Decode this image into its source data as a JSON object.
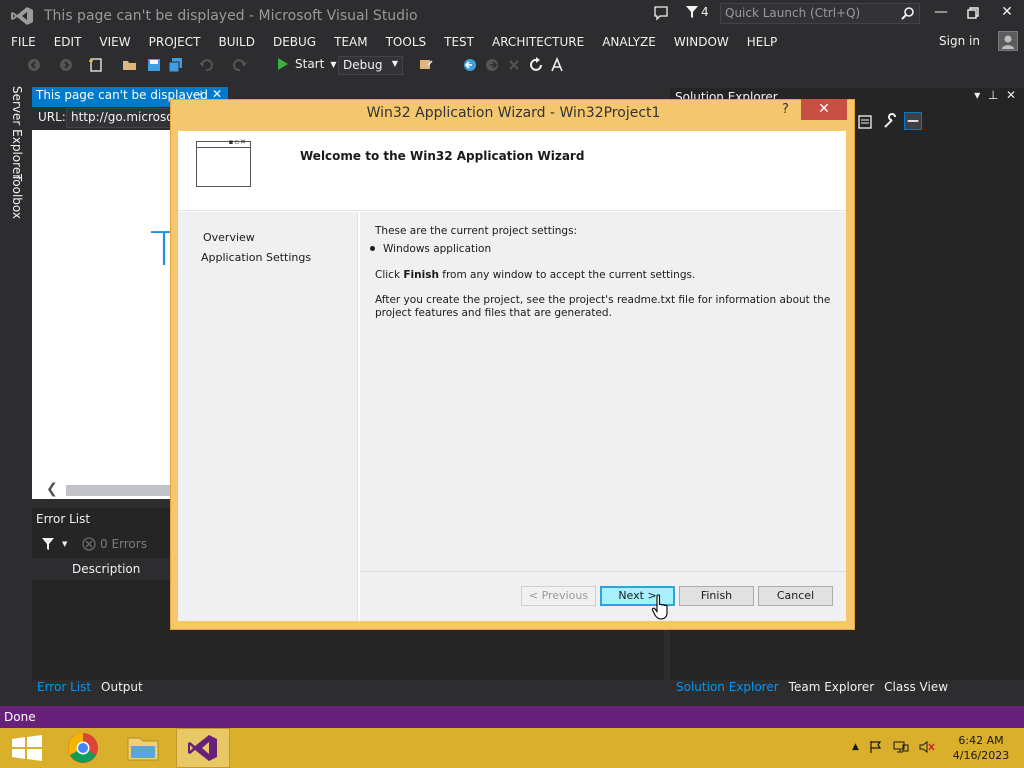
{
  "window": {
    "title": "This page can't be displayed - Microsoft Visual Studio",
    "notification_count": "4",
    "quick_launch_placeholder": "Quick Launch (Ctrl+Q)"
  },
  "menu": [
    "FILE",
    "EDIT",
    "VIEW",
    "PROJECT",
    "BUILD",
    "DEBUG",
    "TEAM",
    "TOOLS",
    "TEST",
    "ARCHITECTURE",
    "ANALYZE",
    "WINDOW",
    "HELP"
  ],
  "account": {
    "signin_label": "Sign in"
  },
  "toolbar": {
    "start_label": "Start",
    "config_value": "Debug"
  },
  "side_tabs": {
    "server_explorer": "Server Explorer",
    "toolbox": "Toolbox"
  },
  "document": {
    "tab_label": "This page can't be displayed",
    "url_label": "URL:",
    "url_value": "http://go.microsoft.com",
    "page_letter": "T"
  },
  "error_list": {
    "title": "Error List",
    "errors_label": "0 Errors",
    "column_description": "Description",
    "bottom_tabs": [
      "Error List",
      "Output"
    ]
  },
  "solution_explorer": {
    "title": "Solution Explorer",
    "bottom_tabs": [
      "Solution Explorer",
      "Team Explorer",
      "Class View"
    ]
  },
  "status": {
    "text": "Done"
  },
  "dialog": {
    "title": "Win32 Application Wizard - Win32Project1",
    "help_label": "?",
    "heading": "Welcome to the Win32 Application Wizard",
    "nav_items": [
      "Overview",
      "Application Settings"
    ],
    "settings_intro": "These are the current project settings:",
    "settings_bullet": "Windows application",
    "finish_pre": "Click ",
    "finish_bold": "Finish",
    "finish_post": " from any window to accept the current settings.",
    "readme_note": "After you create the project, see the project's readme.txt file for information about the project features and files that are generated.",
    "buttons": {
      "previous": "< Previous",
      "next": "Next >",
      "finish": "Finish",
      "cancel": "Cancel"
    }
  },
  "taskbar": {
    "time": "6:42 AM",
    "date": "4/16/2023"
  },
  "colors": {
    "vs_accent": "#007acc",
    "status_bar": "#68217a",
    "taskbar": "#d9af2b",
    "dialog_frame": "#f4c76f",
    "dialog_close": "#c74f43"
  }
}
